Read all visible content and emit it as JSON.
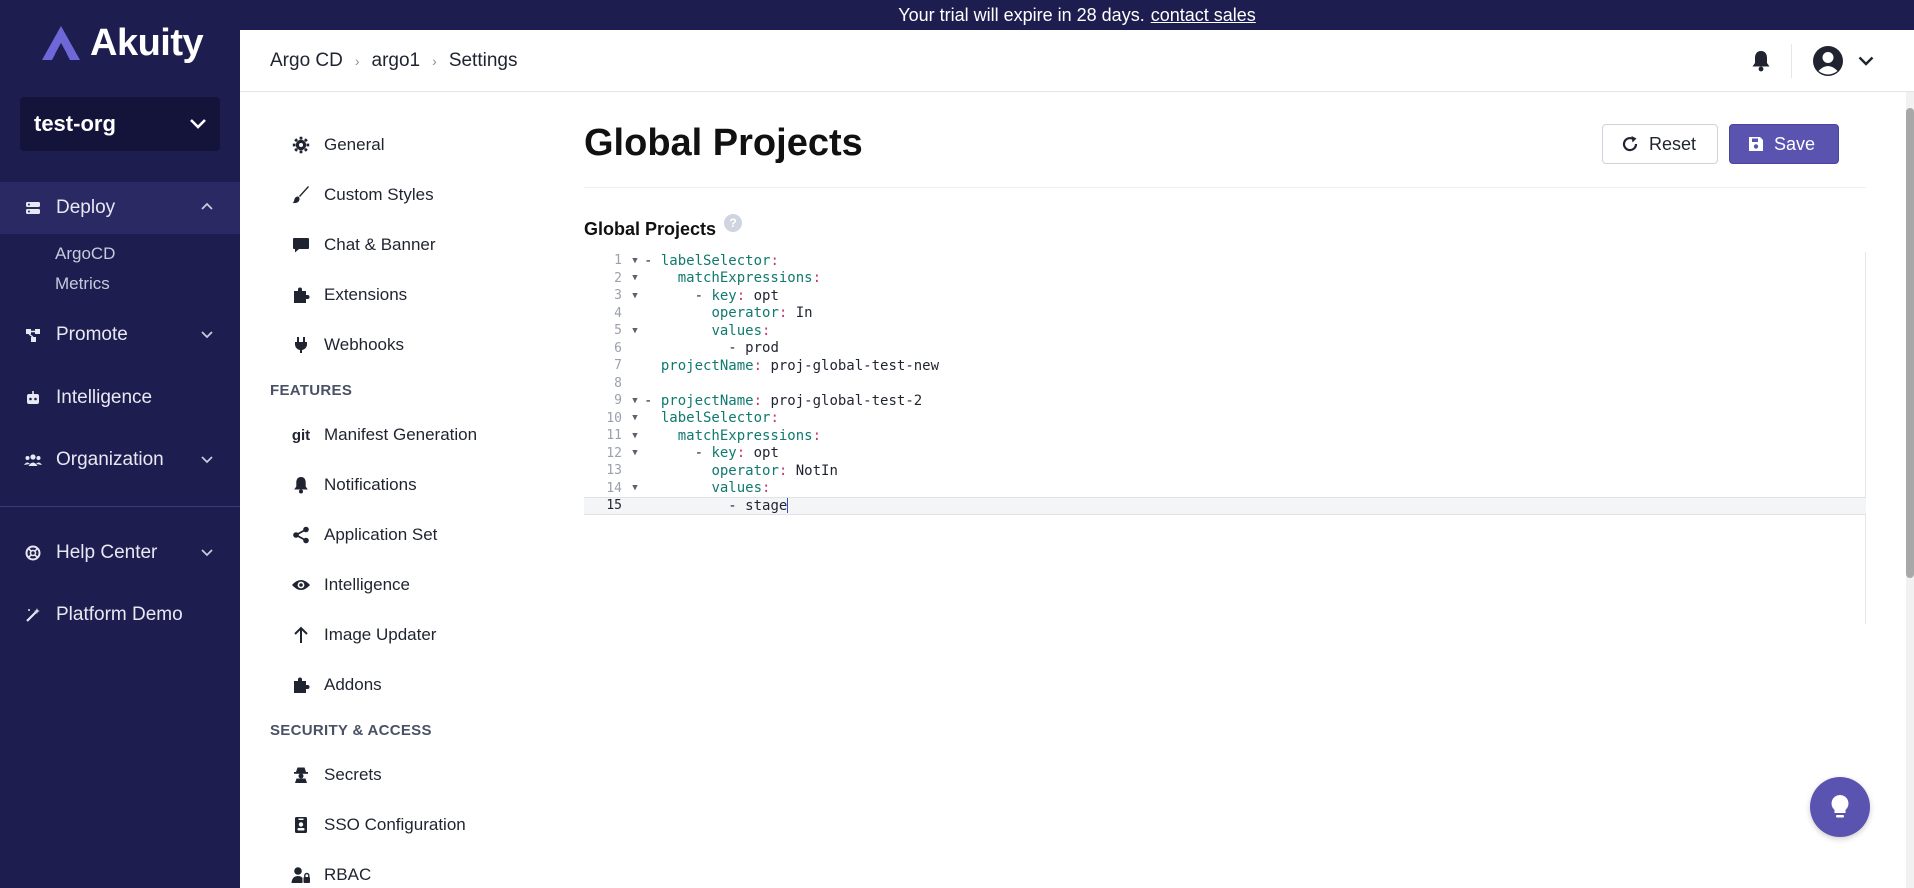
{
  "brand": {
    "name": "Akuity"
  },
  "colors": {
    "sidebar": "#1e1d4f",
    "accent": "#5a53b0",
    "yaml_key": "#0f7a6e",
    "yaml_punct": "#c2376e"
  },
  "org_selector": {
    "value": "test-org"
  },
  "sidebar": {
    "items": [
      {
        "label": "Deploy",
        "icon": "server-icon"
      },
      {
        "label": "Promote",
        "icon": "share-nodes-icon"
      },
      {
        "label": "Intelligence",
        "icon": "robot-icon"
      },
      {
        "label": "Organization",
        "icon": "users-icon"
      },
      {
        "label": "Help Center",
        "icon": "lifebuoy-icon"
      },
      {
        "label": "Platform Demo",
        "icon": "magic-wand-icon"
      }
    ],
    "deploy_sub": [
      "ArgoCD",
      "Metrics"
    ]
  },
  "banner": {
    "text": "Your trial will expire in 28 days.",
    "link": "contact sales"
  },
  "breadcrumb": [
    "Argo CD",
    "argo1",
    "Settings"
  ],
  "settings_nav": {
    "general": [
      {
        "label": "General",
        "icon": "gear-icon"
      },
      {
        "label": "Custom Styles",
        "icon": "paintbrush-icon"
      },
      {
        "label": "Chat & Banner",
        "icon": "chat-icon"
      },
      {
        "label": "Extensions",
        "icon": "puzzle-icon"
      },
      {
        "label": "Webhooks",
        "icon": "plug-icon"
      }
    ],
    "features_title": "FEATURES",
    "features": [
      {
        "label": "Manifest Generation",
        "icon": "git-icon",
        "glyph": "git"
      },
      {
        "label": "Notifications",
        "icon": "bell-icon"
      },
      {
        "label": "Application Set",
        "icon": "share-icon"
      },
      {
        "label": "Intelligence",
        "icon": "eye-icon"
      },
      {
        "label": "Image Updater",
        "icon": "arrow-up-icon"
      },
      {
        "label": "Addons",
        "icon": "puzzle-icon"
      }
    ],
    "security_title": "SECURITY & ACCESS",
    "security": [
      {
        "label": "Secrets",
        "icon": "spy-icon"
      },
      {
        "label": "SSO Configuration",
        "icon": "id-badge-icon"
      },
      {
        "label": "RBAC",
        "icon": "user-lock-icon"
      }
    ]
  },
  "main": {
    "title": "Global Projects",
    "reset_label": "Reset",
    "save_label": "Save",
    "section_label": "Global Projects",
    "help": "?"
  },
  "editor": {
    "current_line": 15,
    "lines": [
      {
        "n": "1",
        "fold": true,
        "indent": "",
        "dash": true,
        "key": "labelSelector",
        "value": ""
      },
      {
        "n": "2",
        "fold": true,
        "indent": "    ",
        "dash": false,
        "key": "matchExpressions",
        "value": ""
      },
      {
        "n": "3",
        "fold": true,
        "indent": "      ",
        "dash": true,
        "key": "key",
        "value": "opt"
      },
      {
        "n": "4",
        "fold": false,
        "indent": "        ",
        "dash": false,
        "key": "operator",
        "value": "In"
      },
      {
        "n": "5",
        "fold": true,
        "indent": "        ",
        "dash": false,
        "key": "values",
        "value": ""
      },
      {
        "n": "6",
        "fold": false,
        "indent": "          ",
        "dash": true,
        "key": "",
        "value": "prod"
      },
      {
        "n": "7",
        "fold": false,
        "indent": "  ",
        "dash": false,
        "key": "projectName",
        "value": "proj-global-test-new"
      },
      {
        "n": "8",
        "fold": false,
        "indent": "",
        "dash": false,
        "key": "",
        "value": ""
      },
      {
        "n": "9",
        "fold": true,
        "indent": "",
        "dash": true,
        "key": "projectName",
        "value": "proj-global-test-2"
      },
      {
        "n": "10",
        "fold": true,
        "indent": "  ",
        "dash": false,
        "key": "labelSelector",
        "value": ""
      },
      {
        "n": "11",
        "fold": true,
        "indent": "    ",
        "dash": false,
        "key": "matchExpressions",
        "value": ""
      },
      {
        "n": "12",
        "fold": true,
        "indent": "      ",
        "dash": true,
        "key": "key",
        "value": "opt"
      },
      {
        "n": "13",
        "fold": false,
        "indent": "        ",
        "dash": false,
        "key": "operator",
        "value": "NotIn"
      },
      {
        "n": "14",
        "fold": true,
        "indent": "        ",
        "dash": false,
        "key": "values",
        "value": ""
      },
      {
        "n": "15",
        "fold": false,
        "indent": "          ",
        "dash": true,
        "key": "",
        "value": "stage"
      }
    ]
  }
}
